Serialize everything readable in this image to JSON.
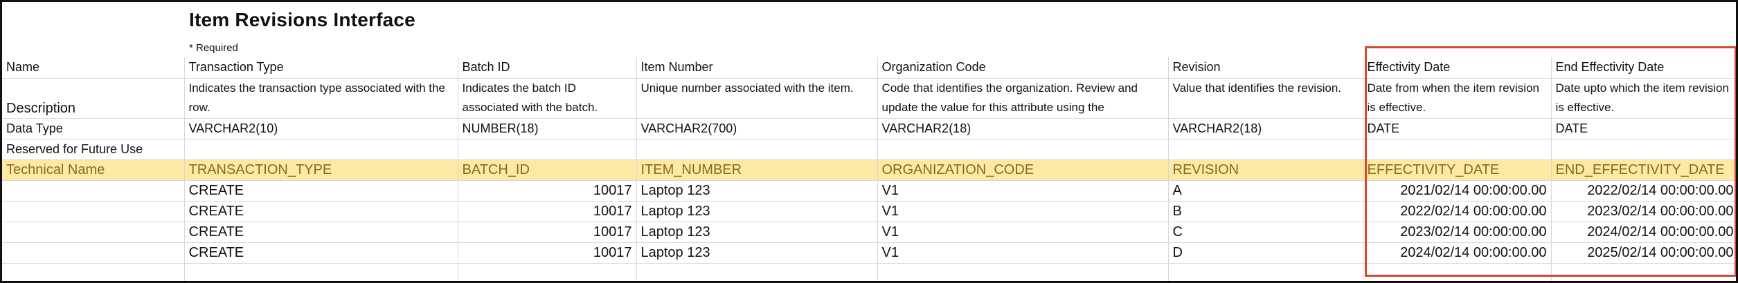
{
  "title": "Item Revisions Interface",
  "required_note": "* Required",
  "rows": {
    "name_label": "Name",
    "description_label": "Description",
    "data_type_label": "Data Type",
    "reserved_label": "Reserved for Future Use",
    "technical_label": "Technical Name"
  },
  "columns": [
    {
      "name": "Transaction Type",
      "description": "Indicates the transaction type associated with the row.",
      "data_type": "VARCHAR2(10)",
      "technical": "TRANSACTION_TYPE"
    },
    {
      "name": "Batch ID",
      "description": "Indicates the batch ID associated with the batch.",
      "data_type": "NUMBER(18)",
      "technical": "BATCH_ID"
    },
    {
      "name": "Item Number",
      "description": "Unique number associated with the item.",
      "data_type": "VARCHAR2(700)",
      "technical": "ITEM_NUMBER"
    },
    {
      "name": "Organization Code",
      "description": "Code that identifies the organization. Review and update the value for this attribute using the",
      "data_type": "VARCHAR2(18)",
      "technical": "ORGANIZATION_CODE"
    },
    {
      "name": "Revision",
      "description": "Value that identifies the revision.",
      "data_type": "VARCHAR2(18)",
      "technical": "REVISION"
    },
    {
      "name": "Effectivity Date",
      "description": "Date from when the item revision is effective.",
      "data_type": "DATE",
      "technical": "EFFECTIVITY_DATE"
    },
    {
      "name": "End Effectivity Date",
      "description": "Date upto which the item revision is effective.",
      "data_type": "DATE",
      "technical": "END_EFFECTIVITY_DATE"
    }
  ],
  "data_rows": [
    [
      "CREATE",
      "10017",
      "Laptop 123",
      "V1",
      "A",
      "2021/02/14 00:00:00.00",
      "2022/02/14 00:00:00.00"
    ],
    [
      "CREATE",
      "10017",
      "Laptop 123",
      "V1",
      "B",
      "2022/02/14 00:00:00.00",
      "2023/02/14 00:00:00.00"
    ],
    [
      "CREATE",
      "10017",
      "Laptop 123",
      "V1",
      "C",
      "2023/02/14 00:00:00.00",
      "2024/02/14 00:00:00.00"
    ],
    [
      "CREATE",
      "10017",
      "Laptop 123",
      "V1",
      "D",
      "2024/02/14 00:00:00.00",
      "2025/02/14 00:00:00.00"
    ]
  ],
  "colors": {
    "technical_row_bg": "#fce9a3",
    "technical_row_text": "#8a6a1b",
    "highlight_border": "#d9482c"
  }
}
